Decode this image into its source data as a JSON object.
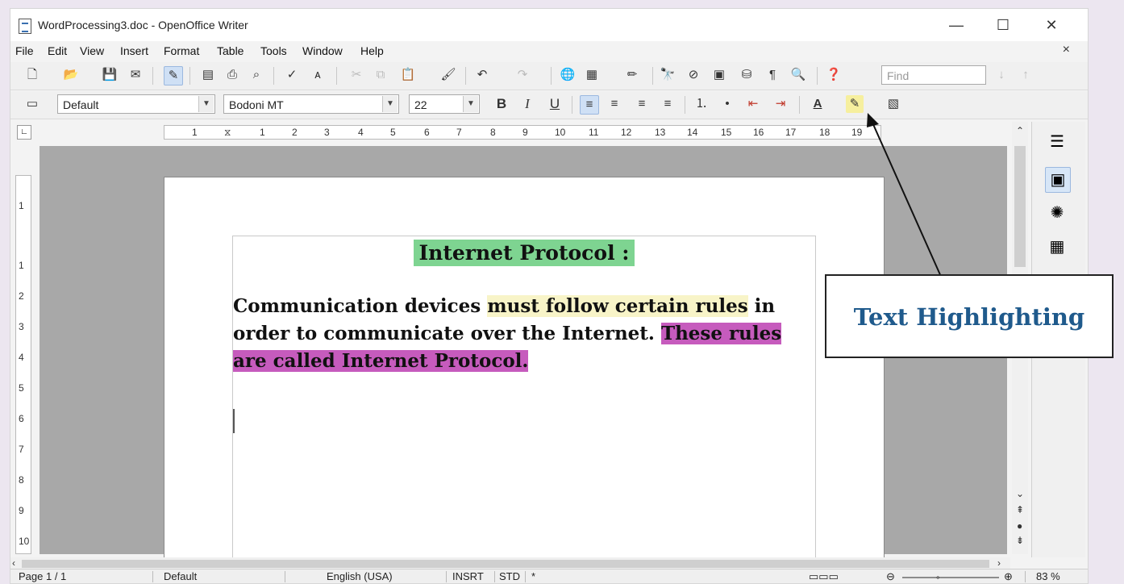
{
  "window": {
    "title": "WordProcessing3.doc - OpenOffice Writer",
    "minimize": "—",
    "maximize": "☐",
    "close": "✕"
  },
  "menu": {
    "items": [
      "File",
      "Edit",
      "View",
      "Insert",
      "Format",
      "Table",
      "Tools",
      "Window",
      "Help"
    ],
    "close_doc": "×"
  },
  "toolbar": {
    "find_placeholder": "Find",
    "icons": [
      "new-icon",
      "open-icon",
      "save-icon",
      "email-icon",
      "edit-mode-icon",
      "pdf-icon",
      "print-icon",
      "print-preview-icon",
      "spellcheck-icon",
      "autospellcheck-icon",
      "cut-icon",
      "copy-icon",
      "paste-icon",
      "format-paintbrush-icon",
      "undo-icon",
      "redo-icon",
      "hyperlink-icon",
      "table-icon",
      "draw-icon",
      "find-replace-icon",
      "navigator-icon",
      "gallery-icon",
      "data-sources-icon",
      "nonprinting-chars-icon",
      "zoom-icon",
      "help-icon"
    ]
  },
  "formatting": {
    "style": "Default",
    "font": "Bodoni MT",
    "size": "22",
    "bold": "B",
    "italic": "I",
    "underline": "U",
    "highlight_color": "#e6d200",
    "font_color": "#1a1a1a"
  },
  "ruler": {
    "marks": [
      "1",
      "1",
      "2",
      "3",
      "4",
      "5",
      "6",
      "7",
      "8",
      "9",
      "10",
      "11",
      "12",
      "13",
      "14",
      "15",
      "16",
      "17",
      "18",
      "19"
    ],
    "vmarks": [
      "1",
      "1",
      "2",
      "3",
      "4",
      "5",
      "6",
      "7",
      "8",
      "9",
      "10"
    ]
  },
  "document": {
    "heading": "Internet Protocol :",
    "para_part1": "Communication devices ",
    "para_part2": "must follow certain rules",
    "para_part3": " in order to communicate over the Internet. ",
    "para_part4": "These rules are called Internet Protocol.",
    "heading_highlight": "#7ed491",
    "yellow_highlight": "#f8f4c8",
    "magenta_highlight": "#c65bbd"
  },
  "status": {
    "page": "Page 1 / 1",
    "style": "Default",
    "language": "English (USA)",
    "insert_mode": "INSRT",
    "selection_mode": "STD",
    "modified": "*",
    "zoom": "83 %"
  },
  "callout": {
    "text": "Text Highlighting"
  }
}
